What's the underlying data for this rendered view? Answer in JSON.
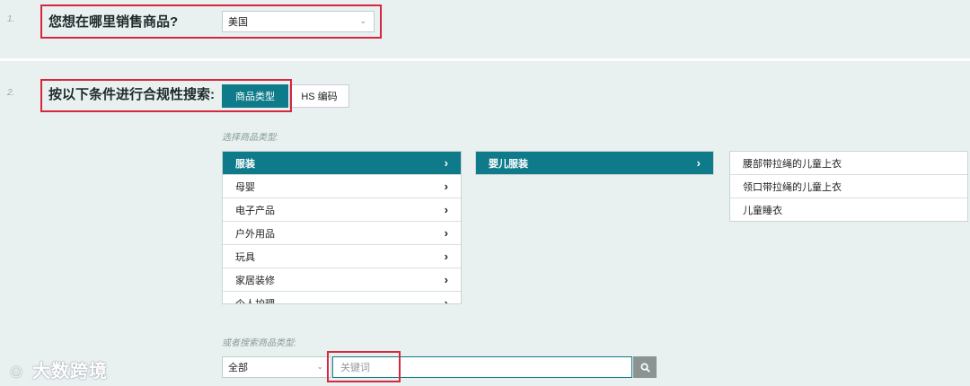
{
  "step1": {
    "number": "1.",
    "question": "您想在哪里销售商品?",
    "country_value": "美国"
  },
  "step2": {
    "number": "2.",
    "question": "按以下条件进行合规性搜索:",
    "tabs": [
      "商品类型",
      "HS 编码"
    ]
  },
  "category": {
    "hint": "选择商品类型:",
    "level1": [
      {
        "label": "服装",
        "arrow": "›"
      },
      {
        "label": "母婴",
        "arrow": "›"
      },
      {
        "label": "电子产品",
        "arrow": "›"
      },
      {
        "label": "户外用品",
        "arrow": "›"
      },
      {
        "label": "玩具",
        "arrow": "›"
      },
      {
        "label": "家居装修",
        "arrow": "›"
      },
      {
        "label": "个人护理",
        "arrow": "›"
      }
    ],
    "level2": [
      {
        "label": "婴儿服装",
        "arrow": "›"
      }
    ],
    "level3": [
      {
        "label": "腰部带拉绳的儿童上衣"
      },
      {
        "label": "领口带拉绳的儿童上衣"
      },
      {
        "label": "儿童睡衣"
      }
    ]
  },
  "search": {
    "hint": "或者搜索商品类型:",
    "scope_value": "全部",
    "keyword_placeholder": "关键词"
  },
  "watermark": "大数跨境",
  "colors": {
    "accent": "#0f7b8a",
    "highlight_box": "#d7263d",
    "background": "#e8f1f0"
  }
}
